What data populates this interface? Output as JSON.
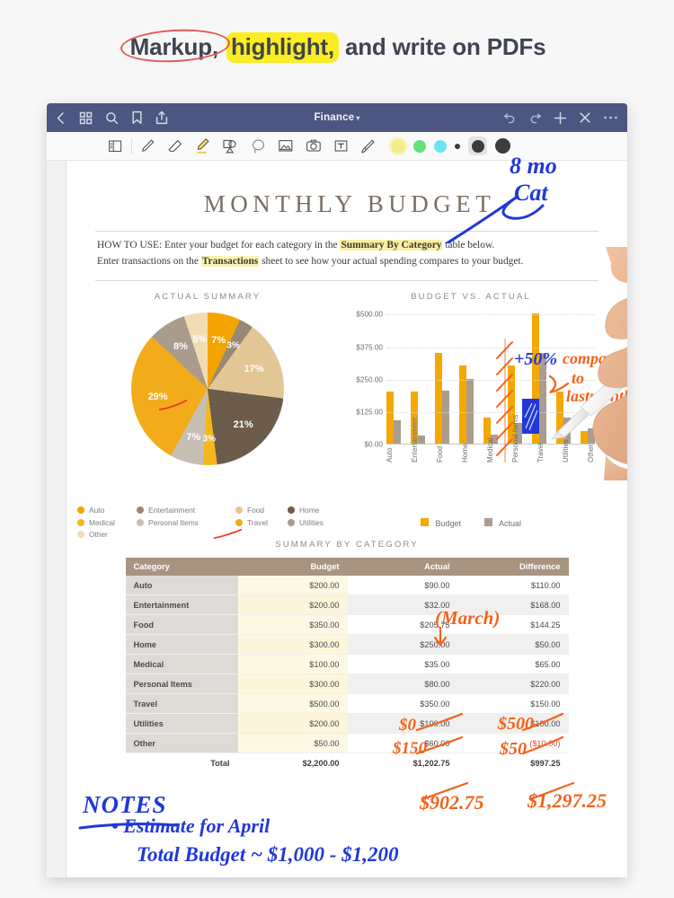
{
  "headline": {
    "part1": "Markup,",
    "part2": "highlight,",
    "part3": "and write on PDFs",
    "circle_color": "#e05a58",
    "highlight_color": "#fbed21"
  },
  "window": {
    "navbar": {
      "title": "Finance",
      "title_caret": "▾",
      "bg_color": "#4d5680",
      "left_icons": [
        "back-chevron-icon",
        "grid-icon",
        "search-icon",
        "bookmark-icon",
        "share-icon"
      ],
      "right_icons": [
        "undo-icon",
        "redo-icon",
        "plus-icon",
        "close-icon",
        "more-icon"
      ]
    },
    "toolbar": {
      "icons": [
        "page-thumbnail-icon",
        "pen-icon",
        "eraser-icon",
        "highlighter-icon",
        "shapes-icon",
        "lasso-icon",
        "image-icon",
        "camera-icon",
        "text-box-icon",
        "brush-icon"
      ],
      "colors": [
        "#f2ef8a",
        "#66e07a",
        "#6ce5f0",
        "#3c3c3c",
        "#3c3c3c",
        "#3c3c3c"
      ],
      "selected_color_index": 4
    }
  },
  "document": {
    "title": "MONTHLY BUDGET",
    "howto_line1_pre": "HOW TO USE: Enter your budget for each category in the ",
    "howto_line1_mark": "Summary By Category",
    "howto_line1_post": " table below.",
    "howto_line2_pre": "Enter transactions on the ",
    "howto_line2_mark": "Transactions",
    "howto_line2_post": " sheet to see how your actual spending compares to your budget."
  },
  "chart_data": [
    {
      "type": "pie",
      "title": "ACTUAL SUMMARY",
      "labels": [
        "Auto",
        "Entertainment",
        "Food",
        "Home",
        "Medical",
        "Personal Items",
        "Travel",
        "Utilities",
        "Other"
      ],
      "values": [
        7,
        3,
        17,
        21,
        3,
        7,
        29,
        8,
        5
      ],
      "value_labels": [
        "7%",
        "3%",
        "17%",
        "21%",
        "3%",
        "7%",
        "29%",
        "8%",
        "5%"
      ],
      "colors": [
        "#f3a400",
        "#998876",
        "#e3c695",
        "#6b5c4b",
        "#f5b81b",
        "#c6bfb5",
        "#f2ac1b",
        "#a99c8d",
        "#f2ddb3"
      ],
      "legend_position": "bottom",
      "annotation": "red-strike-through-29-percent"
    },
    {
      "type": "bar",
      "title": "BUDGET VS. ACTUAL",
      "categories": [
        "Auto",
        "Entertainment",
        "Food",
        "Home",
        "Medical",
        "Personal Items",
        "Travel",
        "Utilities",
        "Other"
      ],
      "series": [
        {
          "name": "Budget",
          "color": "#f4a800",
          "values": [
            200,
            200,
            350,
            300,
            100,
            300,
            500,
            200,
            50
          ]
        },
        {
          "name": "Actual",
          "color": "#aa9d8f",
          "values": [
            90,
            32,
            205.75,
            250,
            35,
            80,
            350,
            100,
            60
          ]
        }
      ],
      "ylabel": "",
      "xlabel": "",
      "ylim": [
        0,
        500
      ],
      "yticks": [
        0,
        125,
        250,
        375,
        500
      ],
      "ytick_labels": [
        "$0.00",
        "$125.00",
        "$250.00",
        "$375.00",
        "$500.00"
      ],
      "grid": true,
      "legend_position": "bottom",
      "legend": [
        "Budget",
        "Actual"
      ]
    }
  ],
  "table": {
    "title": "SUMMARY BY CATEGORY",
    "headers": [
      "Category",
      "Budget",
      "Actual",
      "Difference"
    ],
    "rows": [
      {
        "category": "Auto",
        "budget": "$200.00",
        "actual": "$90.00",
        "difference": "$110.00"
      },
      {
        "category": "Entertainment",
        "budget": "$200.00",
        "actual": "$32.00",
        "difference": "$168.00"
      },
      {
        "category": "Food",
        "budget": "$350.00",
        "actual": "$205.75",
        "difference": "$144.25"
      },
      {
        "category": "Home",
        "budget": "$300.00",
        "actual": "$250.00",
        "difference": "$50.00"
      },
      {
        "category": "Medical",
        "budget": "$100.00",
        "actual": "$35.00",
        "difference": "$65.00"
      },
      {
        "category": "Personal Items",
        "budget": "$300.00",
        "actual": "$80.00",
        "difference": "$220.00"
      },
      {
        "category": "Travel",
        "budget": "$500.00",
        "actual": "$350.00",
        "difference": "$150.00"
      },
      {
        "category": "Utilities",
        "budget": "$200.00",
        "actual": "$100.00",
        "difference": "$100.00"
      },
      {
        "category": "Other",
        "budget": "$50.00",
        "actual": "$60.00",
        "difference": "($10.00)"
      }
    ],
    "total": {
      "label": "Total",
      "budget": "$2,200.00",
      "actual": "$1,202.75",
      "difference": "$997.25"
    }
  },
  "annotations": {
    "blue_top_line1": "8 mo",
    "blue_top_line2": "Cat",
    "blue_plus50": "+50%",
    "orange_compare_line1": "compare",
    "orange_compare_line2": "to",
    "orange_compare_line3": "lastmonth",
    "orange_march": "(March)",
    "travel_actual_edit": "$0",
    "utilities_actual_edit": "$150",
    "travel_diff_edit": "$500",
    "utilities_diff_edit": "$50",
    "total_actual_edit": "$902.75",
    "total_diff_edit": "$1,297.25",
    "notes_heading": "NOTES",
    "notes_line1": "• Estimate for April",
    "notes_line2": "Total Budget ~ $1,000 - $1,200",
    "blue_color": "#2038d8",
    "orange_color": "#f4621a",
    "red_color": "#e8382a"
  }
}
